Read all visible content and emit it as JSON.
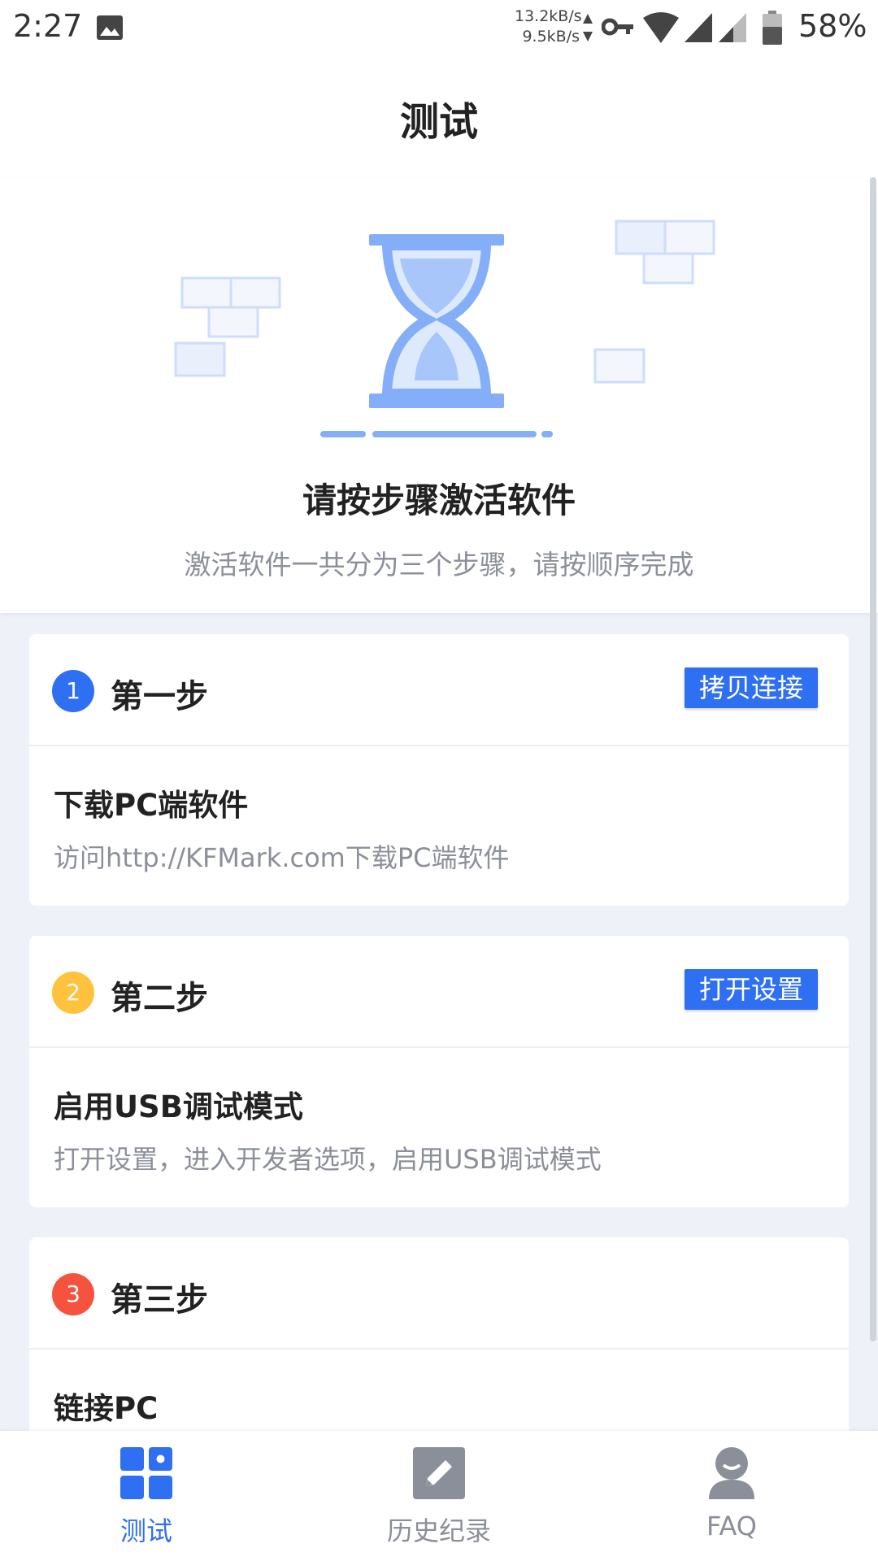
{
  "status_bar": {
    "time": "2:27",
    "net_up": "13.2kB/s",
    "net_down": "9.5kB/s",
    "battery": "58%"
  },
  "header": {
    "title": "测试"
  },
  "hero": {
    "title": "请按步骤激活软件",
    "subtitle": "激活软件一共分为三个步骤，请按顺序完成"
  },
  "steps": [
    {
      "number": "1",
      "title": "第一步",
      "button": "拷贝连接",
      "heading": "下载PC端软件",
      "description": "访问http://KFMark.com下载PC端软件",
      "badge_color": "#2f6ff2"
    },
    {
      "number": "2",
      "title": "第二步",
      "button": "打开设置",
      "heading": "启用USB调试模式",
      "description": "打开设置，进入开发者选项，启用USB调试模式",
      "badge_color": "#ffc23c"
    },
    {
      "number": "3",
      "title": "第三步",
      "heading": "链接PC",
      "badge_color": "#f5533d"
    }
  ],
  "nav": {
    "items": [
      {
        "label": "测试",
        "icon": "grid-icon",
        "active": true
      },
      {
        "label": "历史纪录",
        "icon": "edit-icon",
        "active": false
      },
      {
        "label": "FAQ",
        "icon": "person-icon",
        "active": false
      }
    ]
  },
  "colors": {
    "accent": "#2f6ff2",
    "hourglass": "#84aef8",
    "background": "#eef2f8"
  }
}
